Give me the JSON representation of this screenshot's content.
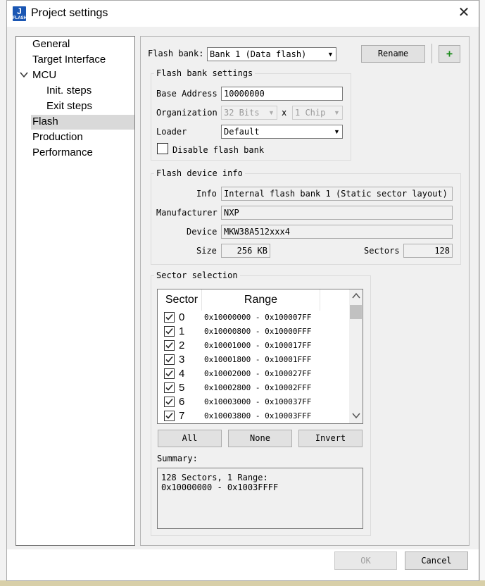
{
  "window": {
    "title": "Project settings",
    "icon_letter": "J",
    "icon_sub": "FLASH"
  },
  "nav": {
    "items": [
      {
        "label": "General"
      },
      {
        "label": "Target Interface"
      },
      {
        "label": "MCU"
      },
      {
        "label": "Init. steps"
      },
      {
        "label": "Exit steps"
      },
      {
        "label": "Flash"
      },
      {
        "label": "Production"
      },
      {
        "label": "Performance"
      }
    ],
    "selected": "Flash"
  },
  "flash": {
    "bank_label": "Flash bank:",
    "bank_value": "Bank 1 (Data flash)",
    "rename_label": "Rename",
    "add_label": "+",
    "settings": {
      "title": "Flash bank settings",
      "base_address_label": "Base Address",
      "base_address_value": "10000000",
      "organization_label": "Organization",
      "org_bits": "32 Bits",
      "org_x": "x",
      "org_chips": "1 Chip",
      "loader_label": "Loader",
      "loader_value": "Default",
      "disable_label": "Disable flash bank"
    },
    "device_info": {
      "title": "Flash device info",
      "info_label": "Info",
      "info_value": "Internal flash bank 1 (Static sector layout)",
      "manufacturer_label": "Manufacturer",
      "manufacturer_value": "NXP",
      "device_label": "Device",
      "device_value": "MKW38A512xxx4",
      "size_label": "Size",
      "size_value": "256 KB",
      "sectors_label": "Sectors",
      "sectors_value": "128"
    },
    "sector_selection": {
      "title": "Sector selection",
      "col_sector": "Sector",
      "col_range": "Range",
      "rows": [
        {
          "sector": "0",
          "range": "0x10000000 - 0x100007FF",
          "checked": true
        },
        {
          "sector": "1",
          "range": "0x10000800 - 0x10000FFF",
          "checked": true
        },
        {
          "sector": "2",
          "range": "0x10001000 - 0x100017FF",
          "checked": true
        },
        {
          "sector": "3",
          "range": "0x10001800 - 0x10001FFF",
          "checked": true
        },
        {
          "sector": "4",
          "range": "0x10002000 - 0x100027FF",
          "checked": true
        },
        {
          "sector": "5",
          "range": "0x10002800 - 0x10002FFF",
          "checked": true
        },
        {
          "sector": "6",
          "range": "0x10003000 - 0x100037FF",
          "checked": true
        },
        {
          "sector": "7",
          "range": "0x10003800 - 0x10003FFF",
          "checked": true
        }
      ],
      "all_label": "All",
      "none_label": "None",
      "invert_label": "Invert",
      "summary_label": "Summary:",
      "summary_line1": "128 Sectors, 1 Range:",
      "summary_line2": "0x10000000 - 0x1003FFFF"
    }
  },
  "footer": {
    "ok_label": "OK",
    "cancel_label": "Cancel"
  }
}
